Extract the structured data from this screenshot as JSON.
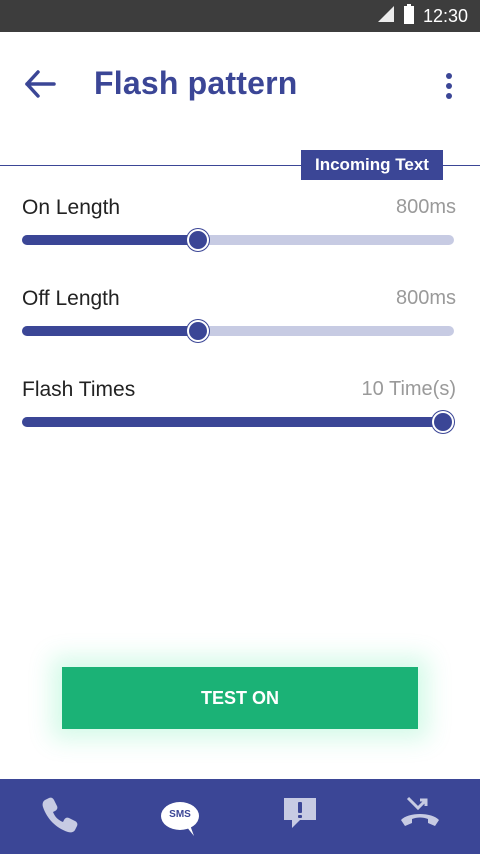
{
  "status_bar": {
    "time": "12:30"
  },
  "app_bar": {
    "title": "Flash pattern"
  },
  "mode_tag": "Incoming Text",
  "settings": [
    {
      "label": "On Length",
      "value": "800ms",
      "level": 0.417
    },
    {
      "label": "Off Length",
      "value": "800ms",
      "level": 0.417
    },
    {
      "label": "Flash Times",
      "value": "10 Time(s)",
      "level": 1.0
    }
  ],
  "test_button": {
    "label": "TEST ON"
  },
  "bottom_nav": {
    "items": [
      {
        "icon": "phone-icon"
      },
      {
        "icon": "sms-icon",
        "label": "SMS"
      },
      {
        "icon": "alert-message-icon"
      },
      {
        "icon": "missed-call-icon"
      }
    ]
  },
  "colors": {
    "primary": "#3b4696",
    "track": "#c7cbe3",
    "accent_green": "#1bb276",
    "status_bar": "#3d3d3d"
  }
}
